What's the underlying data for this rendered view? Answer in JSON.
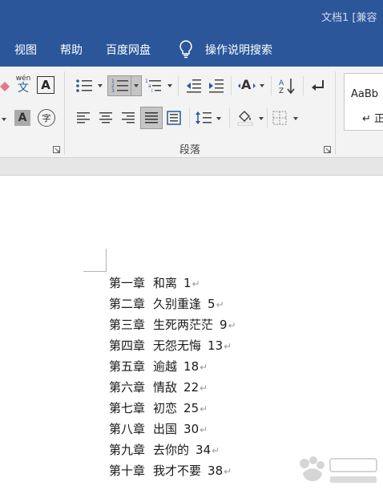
{
  "window": {
    "title": "文档1 [兼容"
  },
  "tabs": [
    {
      "label": "视图"
    },
    {
      "label": "帮助"
    },
    {
      "label": "百度网盘"
    },
    {
      "label": "操作说明搜索"
    }
  ],
  "ribbon": {
    "group_label": "段落",
    "phonetic_label": "wén",
    "phonetic_char": "文",
    "boxed_char": "A",
    "shaded_char": "A",
    "circle_char": "字",
    "style_sample": "AaBb",
    "style_name": "↵ 正"
  },
  "document": {
    "paragraph_mark": "↵",
    "toc": [
      {
        "chapter": "第一章",
        "title": "和离",
        "page": "1"
      },
      {
        "chapter": "第二章",
        "title": "久别重逢",
        "page": "5"
      },
      {
        "chapter": "第三章",
        "title": "生死两茫茫",
        "page": "9"
      },
      {
        "chapter": "第四章",
        "title": "无怨无悔",
        "page": "13"
      },
      {
        "chapter": "第五章",
        "title": "逾越",
        "page": "18"
      },
      {
        "chapter": "第六章",
        "title": "情敌",
        "page": "22"
      },
      {
        "chapter": "第七章",
        "title": "初恋",
        "page": "25"
      },
      {
        "chapter": "第八章",
        "title": "出国",
        "page": "30"
      },
      {
        "chapter": "第九章",
        "title": "去你的",
        "page": "34"
      },
      {
        "chapter": "第十章",
        "title": "我才不要",
        "page": "38"
      }
    ]
  },
  "colors": {
    "ribbon_blue": "#2b579a",
    "selected_button": "#c5c5c5"
  }
}
